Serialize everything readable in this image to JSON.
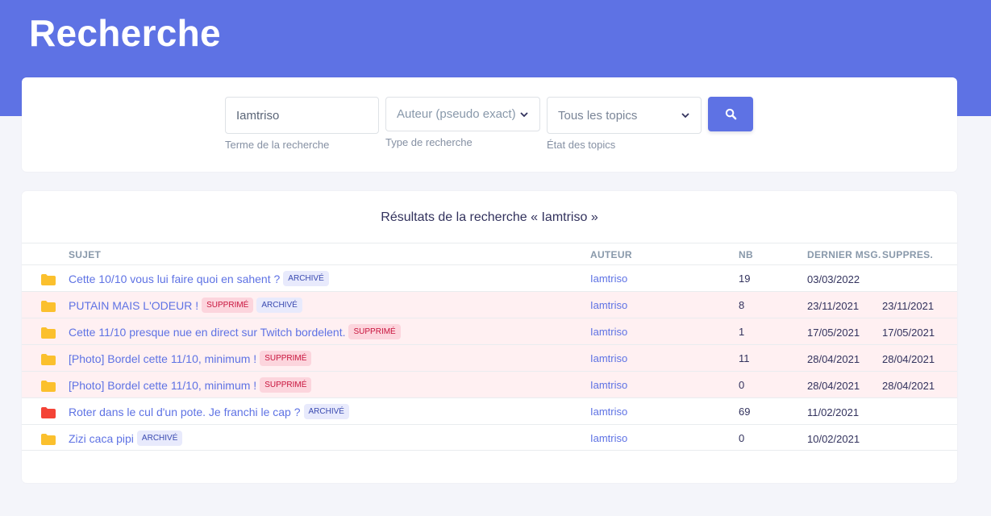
{
  "header": {
    "title": "Recherche"
  },
  "search": {
    "term_value": "Iamtriso",
    "term_help": "Terme de la recherche",
    "type_value": "Auteur (pseudo exact)",
    "type_help": "Type de recherche",
    "state_value": "Tous les topics",
    "state_help": "État des topics"
  },
  "results": {
    "title": "Résultats de la recherche « Iamtriso »",
    "columns": {
      "subject": "SUJET",
      "author": "AUTEUR",
      "nb": "NB",
      "last_msg": "DERNIER MSG.",
      "deleted": "SUPPRES."
    },
    "rows": [
      {
        "subject": "Cette 10/10 vous lui faire quoi en sahent ?",
        "author": "Iamtriso",
        "nb": "19",
        "last_msg": "03/03/2022",
        "deleted": "",
        "badges": [
          "ARCHIVÉ"
        ],
        "folder_color": "#fbc02d",
        "is_deleted": false
      },
      {
        "subject": "PUTAIN MAIS L'ODEUR !",
        "author": "Iamtriso",
        "nb": "8",
        "last_msg": "23/11/2021",
        "deleted": "23/11/2021",
        "badges": [
          "SUPPRIMÉ",
          "ARCHIVÉ"
        ],
        "folder_color": "#fbc02d",
        "is_deleted": true
      },
      {
        "subject": "Cette 11/10 presque nue en direct sur Twitch bordelent.",
        "author": "Iamtriso",
        "nb": "1",
        "last_msg": "17/05/2021",
        "deleted": "17/05/2021",
        "badges": [
          "SUPPRIMÉ"
        ],
        "folder_color": "#fbc02d",
        "is_deleted": true
      },
      {
        "subject": "[Photo] Bordel cette 11/10, minimum !",
        "author": "Iamtriso",
        "nb": "11",
        "last_msg": "28/04/2021",
        "deleted": "28/04/2021",
        "badges": [
          "SUPPRIMÉ"
        ],
        "folder_color": "#fbc02d",
        "is_deleted": true
      },
      {
        "subject": "[Photo] Bordel cette 11/10, minimum !",
        "author": "Iamtriso",
        "nb": "0",
        "last_msg": "28/04/2021",
        "deleted": "28/04/2021",
        "badges": [
          "SUPPRIMÉ"
        ],
        "folder_color": "#fbc02d",
        "is_deleted": true
      },
      {
        "subject": "Roter dans le cul d'un pote. Je franchi le cap ?",
        "author": "Iamtriso",
        "nb": "69",
        "last_msg": "11/02/2021",
        "deleted": "",
        "badges": [
          "ARCHIVÉ"
        ],
        "folder_color": "#f44336",
        "is_deleted": false
      },
      {
        "subject": "Zizi caca pipi",
        "author": "Iamtriso",
        "nb": "0",
        "last_msg": "10/02/2021",
        "deleted": "",
        "badges": [
          "ARCHIVÉ"
        ],
        "folder_color": "#fbc02d",
        "is_deleted": false
      }
    ]
  },
  "colors": {
    "primary": "#5e72e4",
    "deleted_row_bg": "#fff0f2",
    "folder_default": "#fbc02d",
    "folder_hot": "#f44336"
  },
  "icons": {
    "search_button": "search-icon",
    "row_folder": "folder-icon",
    "select_arrow": "chevron-down-icon"
  }
}
